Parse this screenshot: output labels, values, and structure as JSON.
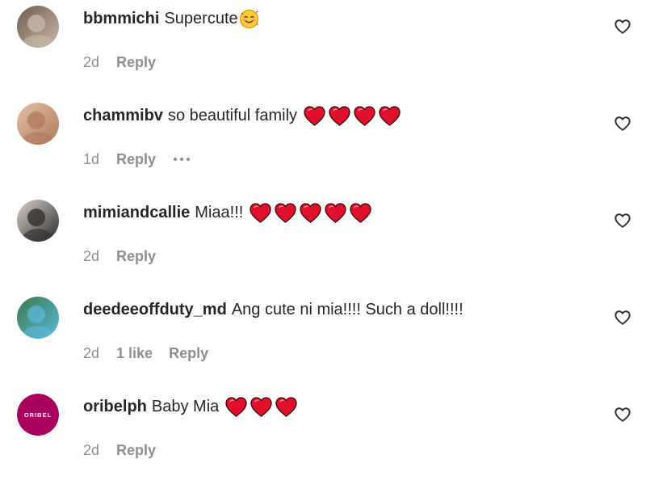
{
  "comments": [
    {
      "username": "bbmmichi",
      "text": "Supercute",
      "emoji": "smiling-face-with-hearts",
      "hearts": 0,
      "time": "2d",
      "likes": "",
      "reply_label": "Reply",
      "has_more": false,
      "avatar_colors": [
        "#c9b9a8",
        "#6e5a4c"
      ]
    },
    {
      "username": "chammibv",
      "text": "so beautiful family",
      "emoji": "",
      "hearts": 4,
      "time": "1d",
      "likes": "",
      "reply_label": "Reply",
      "has_more": true,
      "avatar_colors": [
        "#b07a5a",
        "#e2c1a8"
      ]
    },
    {
      "username": "mimiandcallie",
      "text": "Miaa!!!",
      "emoji": "",
      "hearts": 5,
      "time": "2d",
      "likes": "",
      "reply_label": "Reply",
      "has_more": false,
      "avatar_colors": [
        "#2b2b2b",
        "#d9d2cc"
      ]
    },
    {
      "username": "deedeeoffduty_md",
      "text": "Ang cute ni mia!!!! Such a doll!!!!",
      "emoji": "",
      "hearts": 0,
      "time": "2d",
      "likes": "1 like",
      "reply_label": "Reply",
      "has_more": false,
      "avatar_colors": [
        "#5bb7d8",
        "#3c7a4e"
      ]
    },
    {
      "username": "oribelph",
      "text": "Baby Mia",
      "emoji": "",
      "hearts": 3,
      "time": "2d",
      "likes": "",
      "reply_label": "Reply",
      "has_more": false,
      "avatar_colors": [
        "#a8005c",
        "#ffffff"
      ],
      "avatar_logo": "ORIBEL"
    }
  ],
  "colors": {
    "text": "#262626",
    "secondary": "#8e8e8e",
    "heart_red": "#e0102a"
  },
  "icons": {
    "like_button": "heart-outline-icon",
    "more": "more-horizontal-icon",
    "heart_emoji": "red-heart-emoji",
    "smile_emoji": "smiling-face-with-hearts-emoji"
  }
}
